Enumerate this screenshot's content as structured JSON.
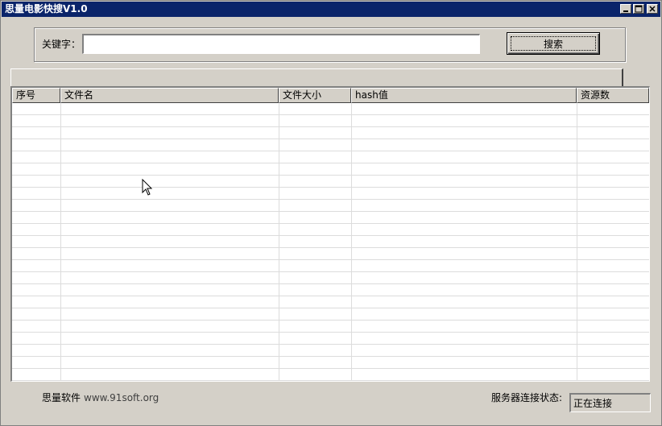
{
  "window": {
    "title": "思量电影快搜V1.0"
  },
  "search": {
    "label": "关键字：",
    "value": "",
    "placeholder": "",
    "button_label": "搜索"
  },
  "table": {
    "columns": [
      "序号",
      "文件名",
      "文件大小",
      "hash值",
      "资源数"
    ],
    "rows": []
  },
  "footer": {
    "brand": "思量软件",
    "site": "www.91soft.org",
    "status_label": "服务器连接状态:",
    "status_value": "正在连接"
  },
  "colors": {
    "titlebar": "#0a246a",
    "face": "#d4d0c8"
  }
}
